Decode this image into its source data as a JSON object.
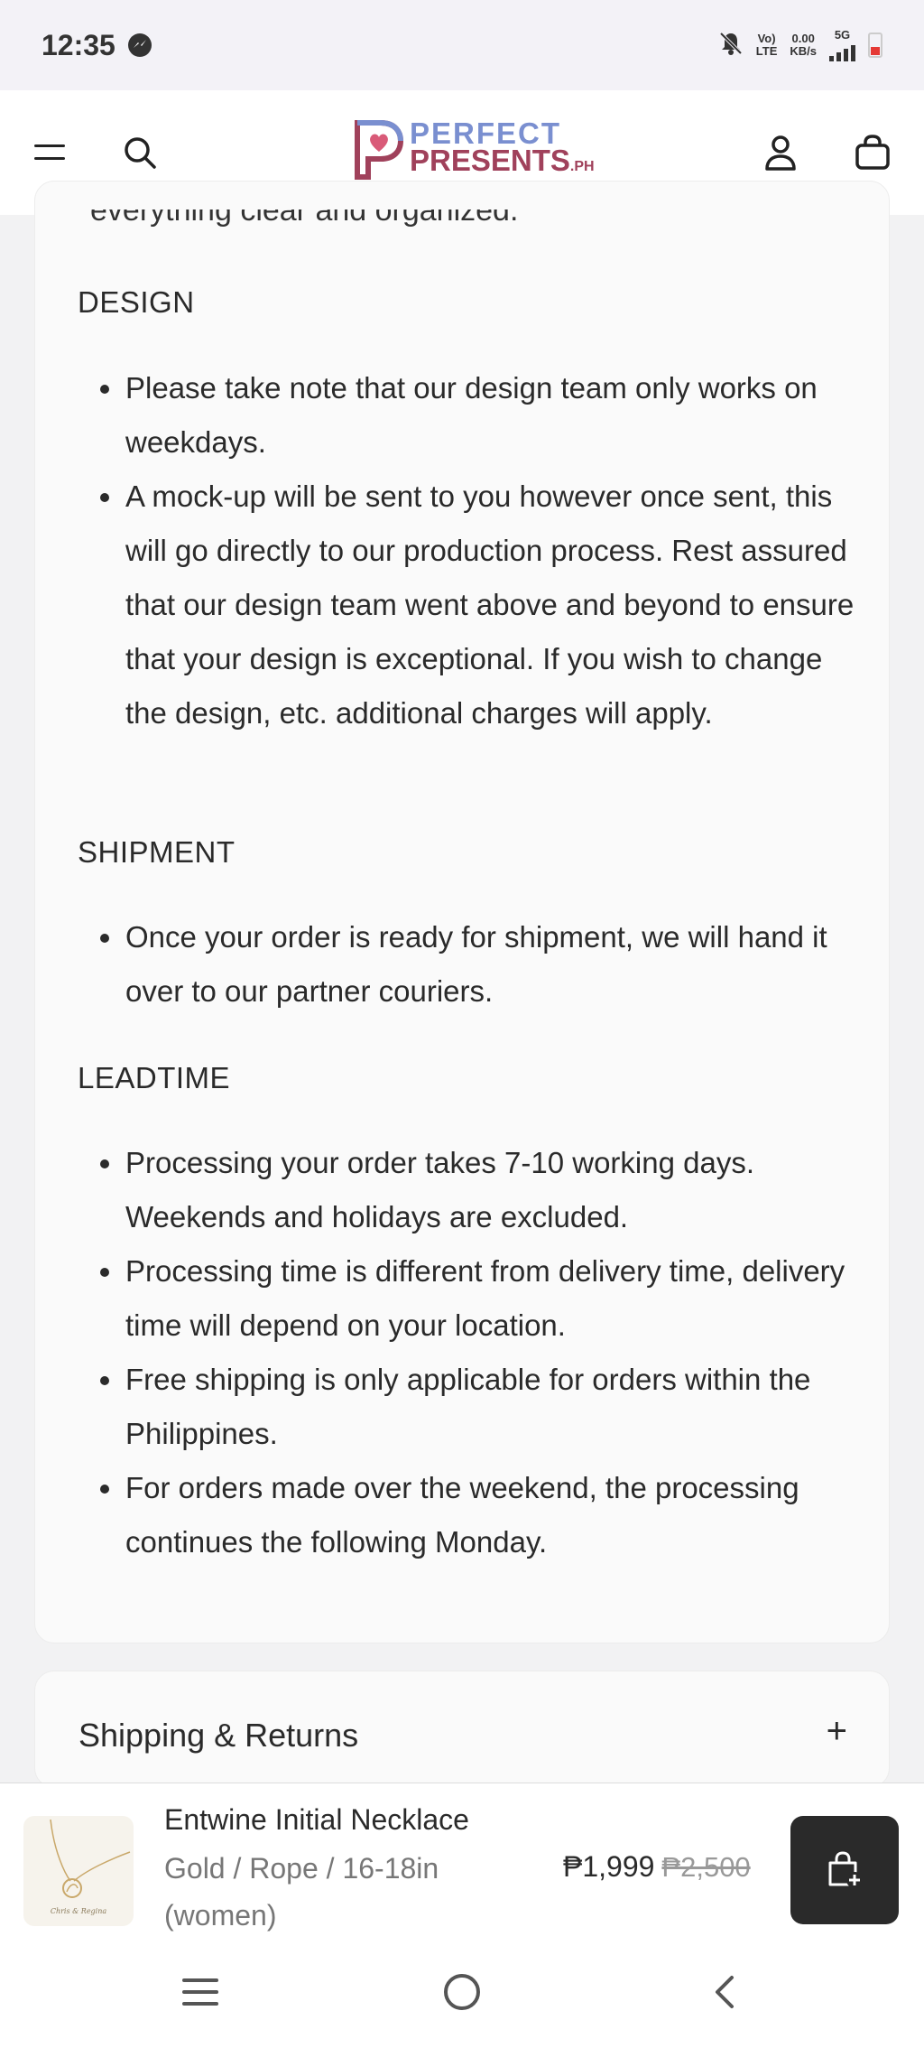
{
  "status": {
    "time": "12:35",
    "volte_top": "Vo)",
    "volte_bottom": "LTE",
    "speed_top": "0.00",
    "speed_bottom": "KB/s",
    "network": "5G"
  },
  "header": {
    "logo_line1": "PERFECT",
    "logo_line2": "PRESENTS",
    "logo_suffix": ".PH",
    "menu_icon": "hamburger-menu-icon",
    "search_icon": "search-icon",
    "account_icon": "user-icon",
    "cart_icon": "shopping-bag-icon"
  },
  "content": {
    "partial_text": "everything clear and organized.",
    "sections": [
      {
        "title": "DESIGN",
        "items": [
          "Please take note that our design team only works on weekdays.",
          "A mock-up will be sent to you however once sent, this will go directly to our production process. Rest assured that our design team went above and beyond to ensure that your design is exceptional. If you wish to change the design, etc. additional charges will apply."
        ]
      },
      {
        "title": "SHIPMENT",
        "items": [
          "Once your order is ready for shipment, we will hand it over to our partner couriers."
        ]
      },
      {
        "title": "LEADTIME",
        "items": [
          "Processing your order takes 7-10 working days. Weekends and holidays are excluded.",
          "Processing time is different from delivery time, delivery time will depend on your location.",
          "Free shipping is only applicable for orders within the Philippines.",
          "For orders made over the weekend, the processing continues the following Monday."
        ]
      }
    ]
  },
  "accordion": {
    "title": "Shipping & Returns",
    "toggle": "+"
  },
  "product_bar": {
    "name": "Entwine Initial Necklace",
    "variant": "Gold / Rope / 16-18in (women)",
    "price": "₱1,999",
    "compare_price": "₱2,500",
    "thumb_caption": "Chris & Regina",
    "add_to_cart_icon": "add-to-bag-icon"
  },
  "navbar": {
    "recent_icon": "recent-apps-icon",
    "home_icon": "home-icon",
    "back_icon": "back-icon"
  },
  "colors": {
    "logo_blue": "#7a8fd0",
    "logo_pink": "#a0415b",
    "button_dark": "#2a2a2a"
  }
}
